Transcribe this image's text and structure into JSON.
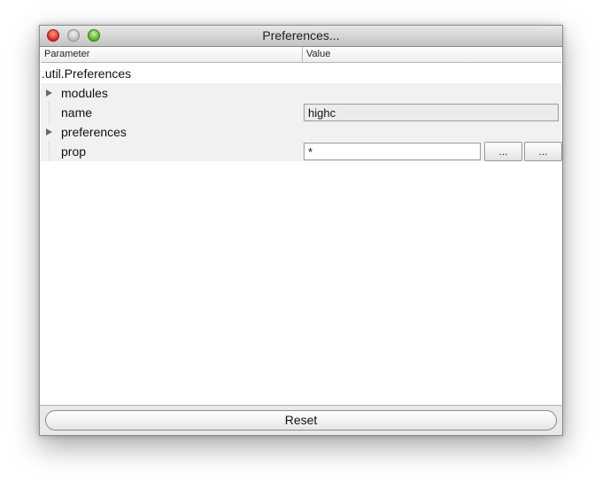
{
  "window": {
    "title": "Preferences..."
  },
  "table": {
    "columns": [
      "Parameter",
      "Value"
    ],
    "root_label": ".util.Preferences",
    "rows": [
      {
        "label": "modules",
        "expandable": true,
        "value": ""
      },
      {
        "label": "name",
        "expandable": false,
        "value": "highc"
      },
      {
        "label": "preferences",
        "expandable": true,
        "value": ""
      },
      {
        "label": "prop",
        "expandable": false,
        "value": "*",
        "buttons": [
          "...",
          "..."
        ]
      }
    ]
  },
  "footer": {
    "reset_label": "Reset"
  },
  "icons": {
    "close": "close-icon",
    "minimize": "minimize-icon",
    "zoom": "zoom-icon",
    "disclosure": "disclosure-triangle-icon"
  },
  "colors": {
    "close": "#d8271d",
    "minimize": "#bdbdbd",
    "zoom": "#4fae22"
  }
}
